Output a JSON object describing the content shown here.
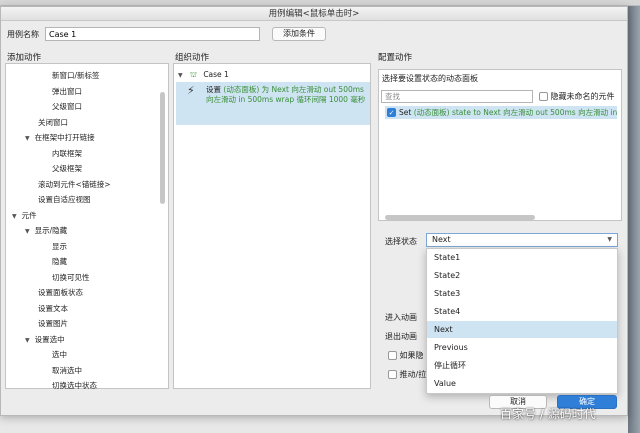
{
  "window": {
    "title": "用例编辑<鼠标单击时>"
  },
  "case_name": {
    "label": "用例名称",
    "value": "Case 1",
    "add_condition": "添加条件"
  },
  "columns": {
    "add_action": "添加动作",
    "organize_action": "组织动作",
    "configure_action": "配置动作"
  },
  "action_tree": [
    "新窗口/新标签",
    "弹出窗口",
    "父级窗口",
    "关闭窗口",
    "在框架中打开链接",
    "内联框架",
    "父级框架",
    "滚动到元件<锚链接>",
    "设置自适应视图",
    "元件",
    "显示/隐藏",
    "显示",
    "隐藏",
    "切换可见性",
    "设置面板状态",
    "设置文本",
    "设置图片",
    "设置选中",
    "选中",
    "取消选中",
    "切换选中状态"
  ],
  "organize": {
    "case_label": "Case 1",
    "action_text_1": "设置",
    "action_text_2": "(动态面板) 为 Next 向左滑动 out 500ms 向左滑动 in 500ms wrap 循环间隔 1000 毫秒"
  },
  "configure": {
    "select_panel_label": "选择要设置状态的动态面板",
    "search_placeholder": "查找",
    "hide_unnamed_label": "隐藏未命名的元件",
    "panel_row_prefix": "Set",
    "panel_row_text": "(动态面板) state to Next 向左滑动 out 500ms 向左滑动 in",
    "select_state_label": "选择状态",
    "selected_state": "Next",
    "state_options": [
      "State1",
      "State2",
      "State3",
      "State4",
      "Next",
      "Previous",
      "停止循环",
      "Value"
    ],
    "enter_anim_label": "进入动画",
    "exit_anim_label": "退出动画",
    "if_hidden_label": "如果隐",
    "push_label": "推动/拉"
  },
  "footer": {
    "cancel": "取消",
    "ok": "确定"
  },
  "watermark": "百家号 / 源码时代"
}
